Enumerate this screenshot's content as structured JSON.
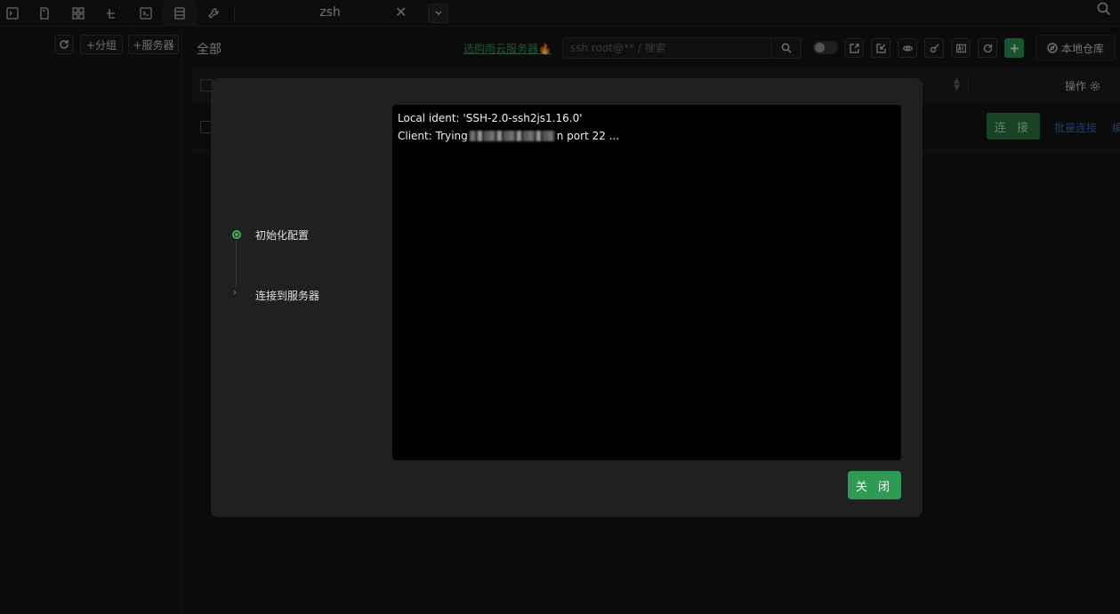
{
  "window": {
    "tab_title": "zsh",
    "tab_close": "✕"
  },
  "sidebar": {
    "add_group_label": "+分组",
    "add_server_label": "+服务器"
  },
  "main": {
    "title": "全部",
    "promo_link": "选购雨云服务器🔥",
    "search_placeholder": "ssh root@** / 搜索",
    "local_repo_label": "本地仓库",
    "ops_header": "操作",
    "row": {
      "connect_label": "连 接",
      "batch_connect_label": "批量连接",
      "edit_label": "编辑"
    }
  },
  "modal": {
    "steps": [
      {
        "label": "初始化配置"
      },
      {
        "label": "连接到服务器"
      }
    ],
    "step2_chevron": "›",
    "terminal_lines": {
      "line1": "Local ident: 'SSH-2.0-ssh2js1.16.0'",
      "line2_prefix": "Client: Trying",
      "line2_suffix": "n port 22 ..."
    },
    "close_label": "关 闭"
  },
  "colors": {
    "accent": "#2f9a53",
    "link": "#3fa35b",
    "background": "#141414"
  },
  "icons": {
    "top": [
      "terminal-icon",
      "file-icon",
      "grid-icon",
      "tree-icon",
      "console-icon",
      "server-icon",
      "wrench-icon"
    ],
    "toolbar": [
      "export-icon",
      "import-icon",
      "eye-icon",
      "key-icon",
      "ai-icon",
      "refresh-icon",
      "plus-icon"
    ]
  }
}
